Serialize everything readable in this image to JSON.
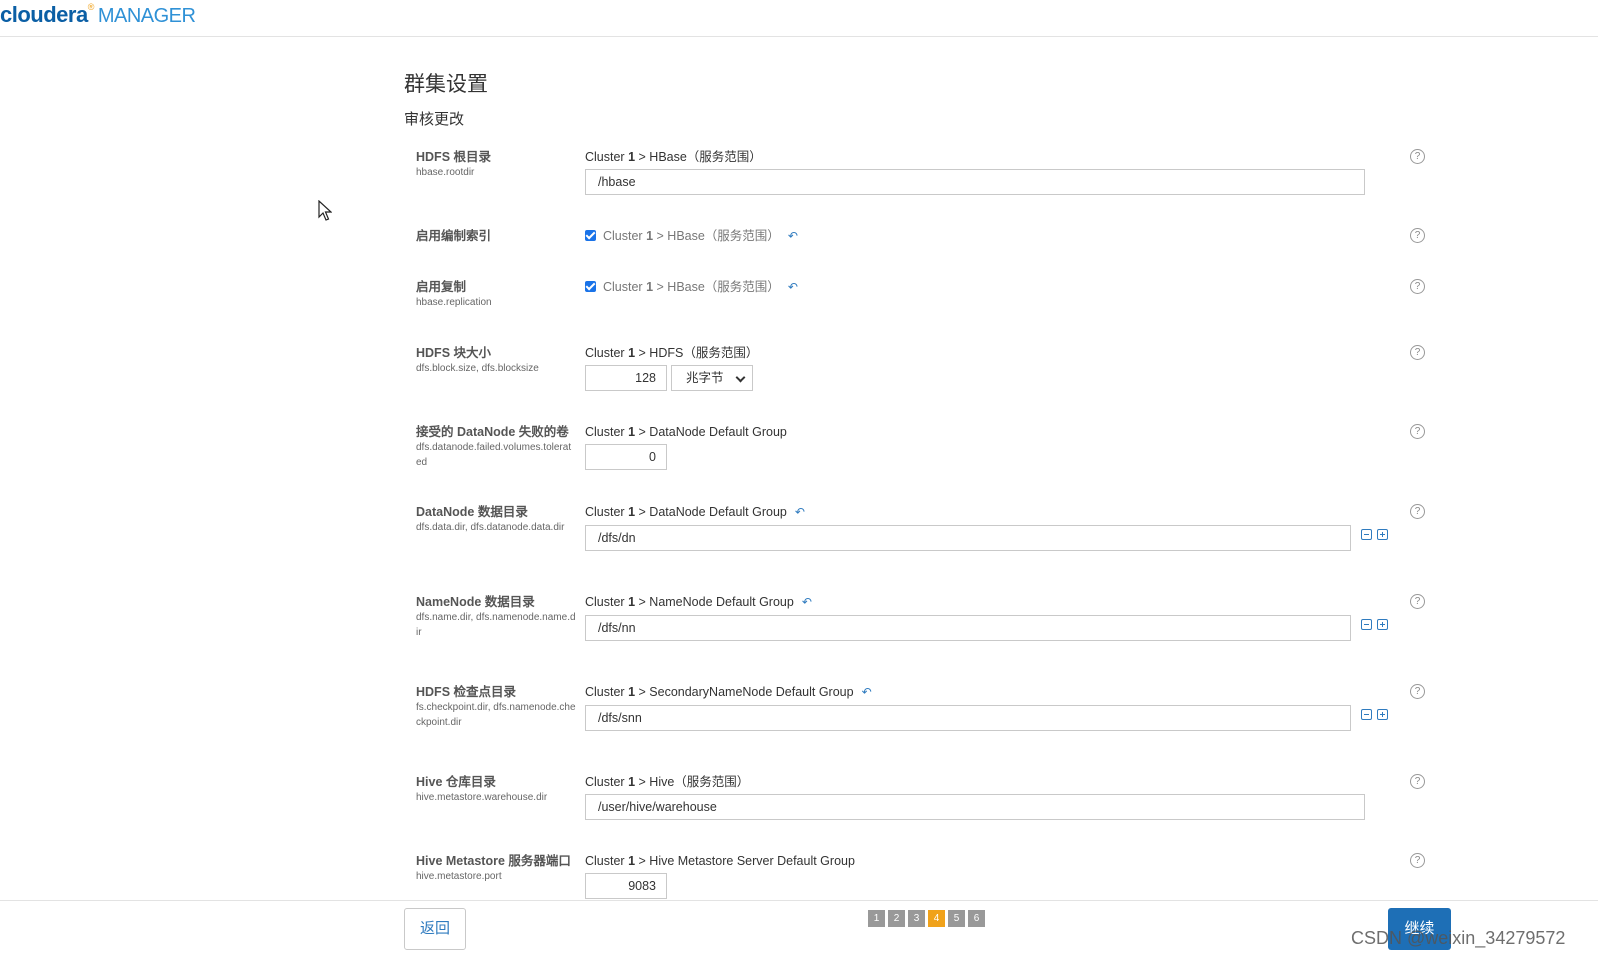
{
  "header": {
    "brand": "cloudera",
    "product": "MANAGER"
  },
  "page": {
    "title": "群集设置",
    "subtitle": "审核更改"
  },
  "settings": [
    {
      "name": "HDFS 根目录",
      "key": "hbase.rootdir",
      "scope_cluster": "Cluster",
      "scope_num": "1",
      "scope_rest": "> HBase（服务范围）",
      "value": "/hbase"
    },
    {
      "name": "启用编制索引",
      "key": "",
      "scope_cluster": "Cluster",
      "scope_num": "1",
      "scope_rest": "> HBase（服务范围）",
      "checked": true
    },
    {
      "name": "启用复制",
      "key": "hbase.replication",
      "scope_cluster": "Cluster",
      "scope_num": "1",
      "scope_rest": "> HBase（服务范围）",
      "checked": true
    },
    {
      "name": "HDFS 块大小",
      "key": "dfs.block.size, dfs.blocksize",
      "scope_cluster": "Cluster",
      "scope_num": "1",
      "scope_rest": "> HDFS（服务范围）",
      "value": "128",
      "unit": "兆字节"
    },
    {
      "name": "接受的 DataNode 失败的卷",
      "key": "dfs.datanode.failed.volumes.tolerated",
      "scope_cluster": "Cluster",
      "scope_num": "1",
      "scope_rest": "> DataNode Default Group",
      "value": "0"
    },
    {
      "name": "DataNode 数据目录",
      "key": "dfs.data.dir, dfs.datanode.data.dir",
      "scope_cluster": "Cluster",
      "scope_num": "1",
      "scope_rest": "> DataNode Default Group",
      "value": "/dfs/dn"
    },
    {
      "name": "NameNode 数据目录",
      "key": "dfs.name.dir, dfs.namenode.name.dir",
      "scope_cluster": "Cluster",
      "scope_num": "1",
      "scope_rest": "> NameNode Default Group",
      "value": "/dfs/nn"
    },
    {
      "name": "HDFS 检查点目录",
      "key": "fs.checkpoint.dir, dfs.namenode.checkpoint.dir",
      "scope_cluster": "Cluster",
      "scope_num": "1",
      "scope_rest": "> SecondaryNameNode Default Group",
      "value": "/dfs/snn"
    },
    {
      "name": "Hive 仓库目录",
      "key": "hive.metastore.warehouse.dir",
      "scope_cluster": "Cluster",
      "scope_num": "1",
      "scope_rest": "> Hive（服务范围）",
      "value": "/user/hive/warehouse"
    },
    {
      "name": "Hive Metastore 服务器端口",
      "key": "hive.metastore.port",
      "scope_cluster": "Cluster",
      "scope_num": "1",
      "scope_rest": "> Hive Metastore Server Default Group",
      "value": "9083"
    }
  ],
  "help_glyph": "?",
  "undo_glyph": "↶",
  "footer": {
    "back_label": "返回",
    "next_label": "继续",
    "pages": [
      "1",
      "2",
      "3",
      "4",
      "5",
      "6"
    ],
    "current_page": "4"
  },
  "watermark": "CSDN @weixin_34279572",
  "colors": {
    "brand": "#0b5fa5",
    "accent": "#f0a21b",
    "primary_button": "#1e6fb6",
    "link": "#2f7bbf"
  }
}
